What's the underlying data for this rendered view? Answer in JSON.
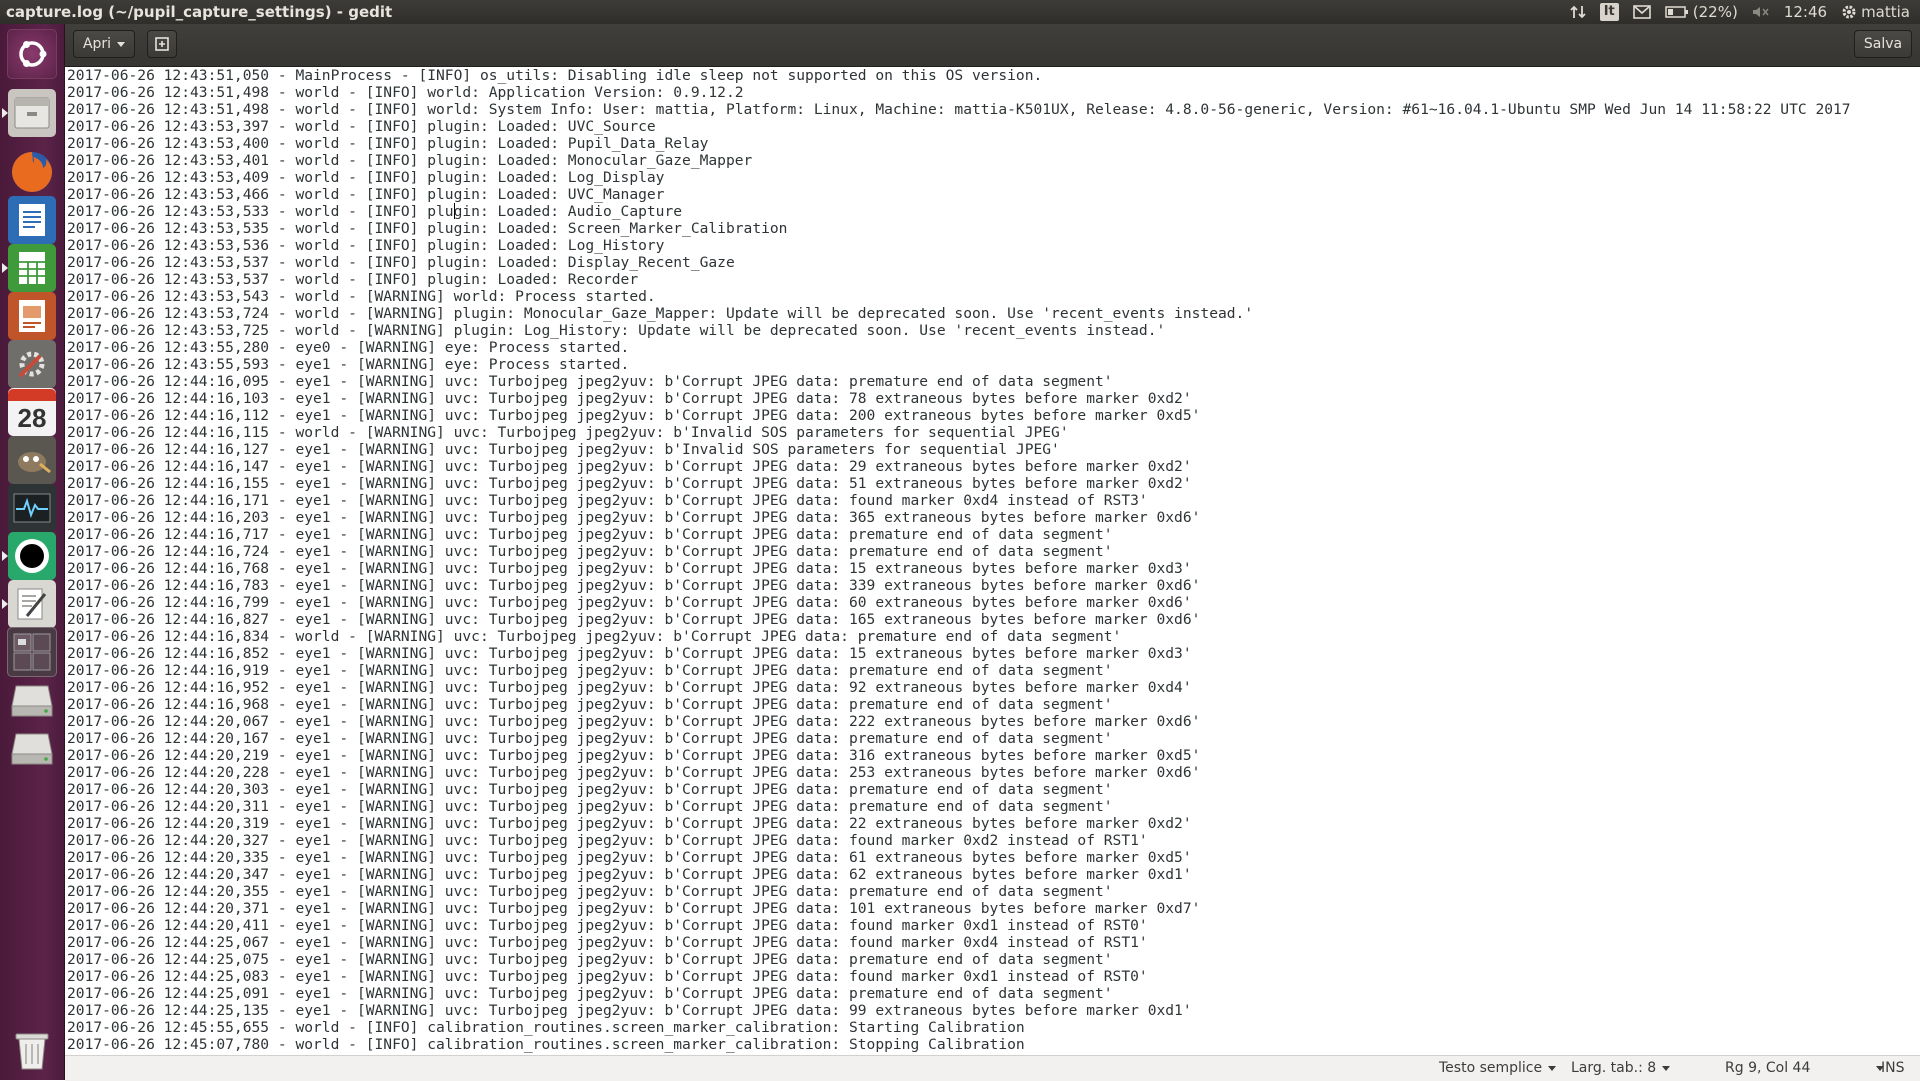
{
  "window": {
    "title": "capture.log (~/pupil_capture_settings) - gedit"
  },
  "panel": {
    "lang": "It",
    "battery": "(22%)",
    "clock": "12:46",
    "user": "mattia"
  },
  "launcher": {
    "items": [
      {
        "name": "dash-button",
        "icon": "ubuntu-logo-icon"
      },
      {
        "name": "files-launcher",
        "icon": "file-manager-icon"
      },
      {
        "name": "firefox-launcher",
        "icon": "firefox-icon"
      },
      {
        "name": "writer-launcher",
        "icon": "document-icon"
      },
      {
        "name": "calc-launcher",
        "icon": "spreadsheet-icon"
      },
      {
        "name": "impress-launcher",
        "icon": "presentation-icon"
      },
      {
        "name": "settings-launcher",
        "icon": "settings-tools-icon"
      },
      {
        "name": "calendar-launcher",
        "icon": "calendar-icon",
        "text": "28"
      },
      {
        "name": "gimp-launcher",
        "icon": "gimp-icon"
      },
      {
        "name": "system-monitor-launcher",
        "icon": "system-monitor-icon"
      },
      {
        "name": "pupil-launcher",
        "icon": "pupil-eye-icon"
      },
      {
        "name": "gedit-launcher",
        "icon": "text-editor-icon"
      },
      {
        "name": "workspace-switcher",
        "icon": "workspaces-icon"
      },
      {
        "name": "drive-launcher-1",
        "icon": "drive-icon"
      },
      {
        "name": "drive-launcher-2",
        "icon": "drive-icon"
      },
      {
        "name": "trash-launcher",
        "icon": "trash-icon"
      }
    ]
  },
  "toolbar": {
    "open_label": "Apri",
    "save_label": "Salva"
  },
  "editor": {
    "caret": "Rg 9, Col 44",
    "lines": [
      "2017-06-26 12:43:51,050 - MainProcess - [INFO] os_utils: Disabling idle sleep not supported on this OS version.",
      "2017-06-26 12:43:51,498 - world - [INFO] world: Application Version: 0.9.12.2",
      "2017-06-26 12:43:51,498 - world - [INFO] world: System Info: User: mattia, Platform: Linux, Machine: mattia-K501UX, Release: 4.8.0-56-generic, Version: #61~16.04.1-Ubuntu SMP Wed Jun 14 11:58:22 UTC 2017",
      "2017-06-26 12:43:53,397 - world - [INFO] plugin: Loaded: UVC_Source",
      "2017-06-26 12:43:53,400 - world - [INFO] plugin: Loaded: Pupil_Data_Relay",
      "2017-06-26 12:43:53,401 - world - [INFO] plugin: Loaded: Monocular_Gaze_Mapper",
      "2017-06-26 12:43:53,409 - world - [INFO] plugin: Loaded: Log_Display",
      "2017-06-26 12:43:53,466 - world - [INFO] plugin: Loaded: UVC_Manager",
      "2017-06-26 12:43:53,533 - world - [INFO] plugin: Loaded: Audio_Capture",
      "2017-06-26 12:43:53,535 - world - [INFO] plugin: Loaded: Screen_Marker_Calibration",
      "2017-06-26 12:43:53,536 - world - [INFO] plugin: Loaded: Log_History",
      "2017-06-26 12:43:53,537 - world - [INFO] plugin: Loaded: Display_Recent_Gaze",
      "2017-06-26 12:43:53,537 - world - [INFO] plugin: Loaded: Recorder",
      "2017-06-26 12:43:53,543 - world - [WARNING] world: Process started.",
      "2017-06-26 12:43:53,724 - world - [WARNING] plugin: Monocular_Gaze_Mapper: Update will be deprecated soon. Use 'recent_events instead.'",
      "2017-06-26 12:43:53,725 - world - [WARNING] plugin: Log_History: Update will be deprecated soon. Use 'recent_events instead.'",
      "2017-06-26 12:43:55,280 - eye0 - [WARNING] eye: Process started.",
      "2017-06-26 12:43:55,593 - eye1 - [WARNING] eye: Process started.",
      "2017-06-26 12:44:16,095 - eye1 - [WARNING] uvc: Turbojpeg jpeg2yuv: b'Corrupt JPEG data: premature end of data segment'",
      "2017-06-26 12:44:16,103 - eye1 - [WARNING] uvc: Turbojpeg jpeg2yuv: b'Corrupt JPEG data: 78 extraneous bytes before marker 0xd2'",
      "2017-06-26 12:44:16,112 - eye1 - [WARNING] uvc: Turbojpeg jpeg2yuv: b'Corrupt JPEG data: 200 extraneous bytes before marker 0xd5'",
      "2017-06-26 12:44:16,115 - world - [WARNING] uvc: Turbojpeg jpeg2yuv: b'Invalid SOS parameters for sequential JPEG'",
      "2017-06-26 12:44:16,127 - eye1 - [WARNING] uvc: Turbojpeg jpeg2yuv: b'Invalid SOS parameters for sequential JPEG'",
      "2017-06-26 12:44:16,147 - eye1 - [WARNING] uvc: Turbojpeg jpeg2yuv: b'Corrupt JPEG data: 29 extraneous bytes before marker 0xd2'",
      "2017-06-26 12:44:16,155 - eye1 - [WARNING] uvc: Turbojpeg jpeg2yuv: b'Corrupt JPEG data: 51 extraneous bytes before marker 0xd2'",
      "2017-06-26 12:44:16,171 - eye1 - [WARNING] uvc: Turbojpeg jpeg2yuv: b'Corrupt JPEG data: found marker 0xd4 instead of RST3'",
      "2017-06-26 12:44:16,203 - eye1 - [WARNING] uvc: Turbojpeg jpeg2yuv: b'Corrupt JPEG data: 365 extraneous bytes before marker 0xd6'",
      "2017-06-26 12:44:16,717 - eye1 - [WARNING] uvc: Turbojpeg jpeg2yuv: b'Corrupt JPEG data: premature end of data segment'",
      "2017-06-26 12:44:16,724 - eye1 - [WARNING] uvc: Turbojpeg jpeg2yuv: b'Corrupt JPEG data: premature end of data segment'",
      "2017-06-26 12:44:16,768 - eye1 - [WARNING] uvc: Turbojpeg jpeg2yuv: b'Corrupt JPEG data: 15 extraneous bytes before marker 0xd3'",
      "2017-06-26 12:44:16,783 - eye1 - [WARNING] uvc: Turbojpeg jpeg2yuv: b'Corrupt JPEG data: 339 extraneous bytes before marker 0xd6'",
      "2017-06-26 12:44:16,799 - eye1 - [WARNING] uvc: Turbojpeg jpeg2yuv: b'Corrupt JPEG data: 60 extraneous bytes before marker 0xd6'",
      "2017-06-26 12:44:16,827 - eye1 - [WARNING] uvc: Turbojpeg jpeg2yuv: b'Corrupt JPEG data: 165 extraneous bytes before marker 0xd6'",
      "2017-06-26 12:44:16,834 - world - [WARNING] uvc: Turbojpeg jpeg2yuv: b'Corrupt JPEG data: premature end of data segment'",
      "2017-06-26 12:44:16,852 - eye1 - [WARNING] uvc: Turbojpeg jpeg2yuv: b'Corrupt JPEG data: 15 extraneous bytes before marker 0xd3'",
      "2017-06-26 12:44:16,919 - eye1 - [WARNING] uvc: Turbojpeg jpeg2yuv: b'Corrupt JPEG data: premature end of data segment'",
      "2017-06-26 12:44:16,952 - eye1 - [WARNING] uvc: Turbojpeg jpeg2yuv: b'Corrupt JPEG data: 92 extraneous bytes before marker 0xd4'",
      "2017-06-26 12:44:16,968 - eye1 - [WARNING] uvc: Turbojpeg jpeg2yuv: b'Corrupt JPEG data: premature end of data segment'",
      "2017-06-26 12:44:20,067 - eye1 - [WARNING] uvc: Turbojpeg jpeg2yuv: b'Corrupt JPEG data: 222 extraneous bytes before marker 0xd6'",
      "2017-06-26 12:44:20,167 - eye1 - [WARNING] uvc: Turbojpeg jpeg2yuv: b'Corrupt JPEG data: premature end of data segment'",
      "2017-06-26 12:44:20,219 - eye1 - [WARNING] uvc: Turbojpeg jpeg2yuv: b'Corrupt JPEG data: 316 extraneous bytes before marker 0xd5'",
      "2017-06-26 12:44:20,228 - eye1 - [WARNING] uvc: Turbojpeg jpeg2yuv: b'Corrupt JPEG data: 253 extraneous bytes before marker 0xd6'",
      "2017-06-26 12:44:20,303 - eye1 - [WARNING] uvc: Turbojpeg jpeg2yuv: b'Corrupt JPEG data: premature end of data segment'",
      "2017-06-26 12:44:20,311 - eye1 - [WARNING] uvc: Turbojpeg jpeg2yuv: b'Corrupt JPEG data: premature end of data segment'",
      "2017-06-26 12:44:20,319 - eye1 - [WARNING] uvc: Turbojpeg jpeg2yuv: b'Corrupt JPEG data: 22 extraneous bytes before marker 0xd2'",
      "2017-06-26 12:44:20,327 - eye1 - [WARNING] uvc: Turbojpeg jpeg2yuv: b'Corrupt JPEG data: found marker 0xd2 instead of RST1'",
      "2017-06-26 12:44:20,335 - eye1 - [WARNING] uvc: Turbojpeg jpeg2yuv: b'Corrupt JPEG data: 61 extraneous bytes before marker 0xd5'",
      "2017-06-26 12:44:20,347 - eye1 - [WARNING] uvc: Turbojpeg jpeg2yuv: b'Corrupt JPEG data: 62 extraneous bytes before marker 0xd1'",
      "2017-06-26 12:44:20,355 - eye1 - [WARNING] uvc: Turbojpeg jpeg2yuv: b'Corrupt JPEG data: premature end of data segment'",
      "2017-06-26 12:44:20,371 - eye1 - [WARNING] uvc: Turbojpeg jpeg2yuv: b'Corrupt JPEG data: 101 extraneous bytes before marker 0xd7'",
      "2017-06-26 12:44:20,411 - eye1 - [WARNING] uvc: Turbojpeg jpeg2yuv: b'Corrupt JPEG data: found marker 0xd1 instead of RST0'",
      "2017-06-26 12:44:25,067 - eye1 - [WARNING] uvc: Turbojpeg jpeg2yuv: b'Corrupt JPEG data: found marker 0xd4 instead of RST1'",
      "2017-06-26 12:44:25,075 - eye1 - [WARNING] uvc: Turbojpeg jpeg2yuv: b'Corrupt JPEG data: premature end of data segment'",
      "2017-06-26 12:44:25,083 - eye1 - [WARNING] uvc: Turbojpeg jpeg2yuv: b'Corrupt JPEG data: found marker 0xd1 instead of RST0'",
      "2017-06-26 12:44:25,091 - eye1 - [WARNING] uvc: Turbojpeg jpeg2yuv: b'Corrupt JPEG data: premature end of data segment'",
      "2017-06-26 12:44:25,135 - eye1 - [WARNING] uvc: Turbojpeg jpeg2yuv: b'Corrupt JPEG data: 99 extraneous bytes before marker 0xd1'",
      "2017-06-26 12:45:55,655 - world - [INFO] calibration_routines.screen_marker_calibration: Starting Calibration",
      "2017-06-26 12:45:07,780 - world - [INFO] calibration_routines.screen_marker_calibration: Stopping Calibration"
    ]
  },
  "statusbar": {
    "syntax": "Testo semplice",
    "tab_width": "Larg. tab.: 8",
    "position": "Rg 9, Col 44",
    "mode": "INS"
  },
  "colors": {
    "launcher": "#5b2348",
    "panel": "#3c3b37",
    "text": "#2e3436"
  }
}
